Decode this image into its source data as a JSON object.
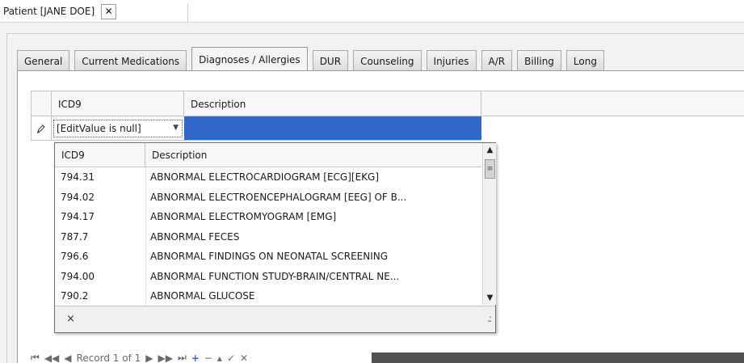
{
  "document": {
    "tab_title": "Patient [JANE DOE]",
    "close_glyph": "✕"
  },
  "tabs": [
    {
      "label": "General",
      "active": false
    },
    {
      "label": "Current Medications",
      "active": false
    },
    {
      "label": "Diagnoses / Allergies",
      "active": true
    },
    {
      "label": "DUR",
      "active": false
    },
    {
      "label": "Counseling",
      "active": false
    },
    {
      "label": "Injuries",
      "active": false
    },
    {
      "label": "A/R",
      "active": false
    },
    {
      "label": "Billing",
      "active": false
    },
    {
      "label": "Long",
      "active": false
    }
  ],
  "grid": {
    "columns": [
      "ICD9",
      "Description"
    ],
    "row_indicator_icon": "pencil-icon",
    "edit_value": "[EditValue is null]"
  },
  "popup": {
    "columns": [
      "ICD9",
      "Description"
    ],
    "rows": [
      [
        "794.31",
        "ABNORMAL ELECTROCARDIOGRAM [ECG][EKG]"
      ],
      [
        "794.02",
        "ABNORMAL ELECTROENCEPHALOGRAM [EEG] OF B..."
      ],
      [
        "794.17",
        "ABNORMAL ELECTROMYOGRAM [EMG]"
      ],
      [
        "787.7",
        "ABNORMAL FECES"
      ],
      [
        "796.6",
        "ABNORMAL FINDINGS ON NEONATAL SCREENING"
      ],
      [
        "794.00",
        "ABNORMAL FUNCTION STUDY-BRAIN/CENTRAL NE..."
      ],
      [
        "790.2",
        "ABNORMAL GLUCOSE"
      ]
    ],
    "close_glyph": "×",
    "grip_glyph": ".:"
  },
  "navigator": {
    "record_label": "Record 1 of 1"
  },
  "colors": {
    "selection": "#3167c8",
    "panel_bg": "#f2f2f2"
  }
}
